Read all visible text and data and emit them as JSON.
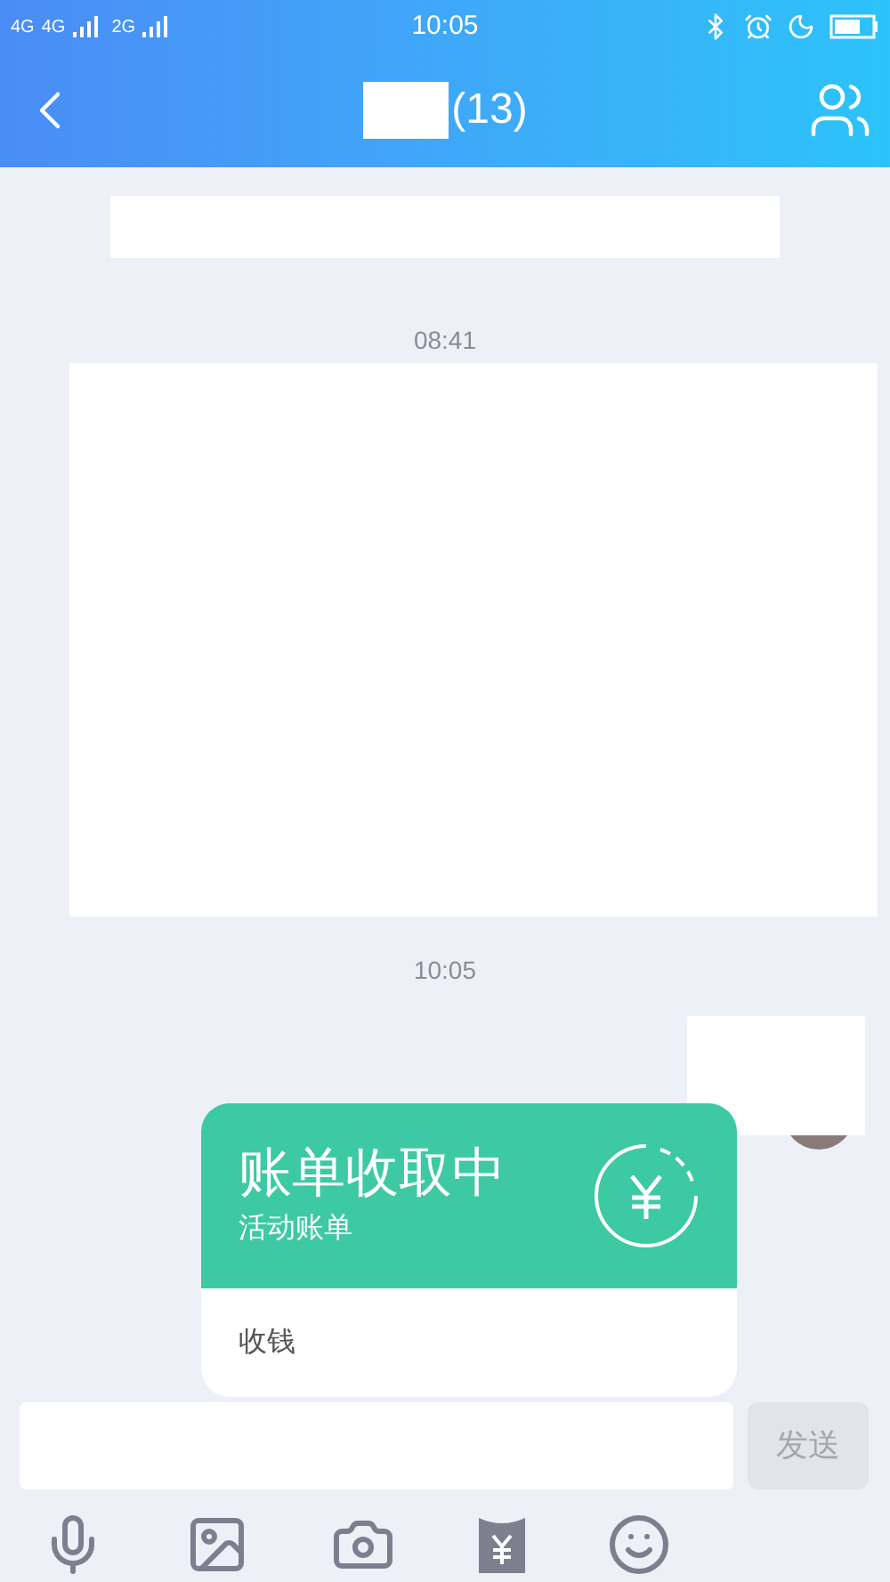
{
  "status_bar": {
    "network": "4G",
    "network_2": "4G",
    "network_3": "2G",
    "time": "10:05"
  },
  "header": {
    "title": "(13)"
  },
  "messages": [
    {
      "kind": "redacted"
    },
    {
      "kind": "timestamp",
      "text": "08:41"
    },
    {
      "kind": "redacted"
    },
    {
      "kind": "timestamp",
      "text": "10:05"
    },
    {
      "kind": "bill",
      "title": "账单收取中",
      "subtitle": "活动账单",
      "action": "收钱"
    }
  ],
  "input": {
    "send_label": "发送",
    "send_disabled": true
  },
  "toolbar": [
    {
      "kind": "mic"
    },
    {
      "kind": "image"
    },
    {
      "kind": "camera"
    },
    {
      "kind": "envelope"
    },
    {
      "kind": "emoji"
    }
  ]
}
